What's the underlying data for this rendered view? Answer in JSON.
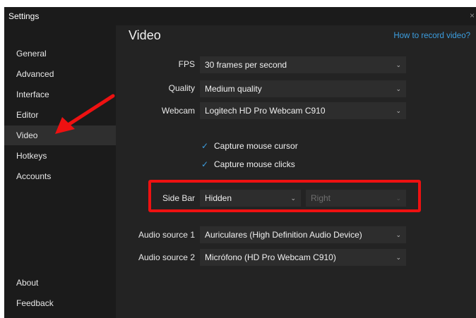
{
  "window": {
    "title": "Settings",
    "close_glyph": "×"
  },
  "sidebar": {
    "items": [
      {
        "label": "General"
      },
      {
        "label": "Advanced"
      },
      {
        "label": "Interface"
      },
      {
        "label": "Editor"
      },
      {
        "label": "Video"
      },
      {
        "label": "Hotkeys"
      },
      {
        "label": "Accounts"
      }
    ],
    "bottom_items": [
      {
        "label": "About"
      },
      {
        "label": "Feedback"
      }
    ],
    "active": "Video"
  },
  "main": {
    "title": "Video",
    "help_link": "How to record video?",
    "fps": {
      "label": "FPS",
      "value": "30 frames per second"
    },
    "quality": {
      "label": "Quality",
      "value": "Medium quality"
    },
    "webcam": {
      "label": "Webcam",
      "value": "Logitech HD Pro Webcam C910"
    },
    "capture_cursor": {
      "label": "Capture mouse cursor",
      "checked": true
    },
    "capture_clicks": {
      "label": "Capture mouse clicks",
      "checked": true
    },
    "side_bar": {
      "label": "Side Bar",
      "value": "Hidden",
      "position": "Right"
    },
    "audio1": {
      "label": "Audio source 1",
      "value": "Auriculares (High Definition Audio Device)"
    },
    "audio2": {
      "label": "Audio source 2",
      "value": "Micrófono (HD Pro Webcam C910)"
    }
  },
  "icons": {
    "chevron": "chevron-down-icon",
    "check": "checkmark-icon",
    "close": "close-icon"
  },
  "colors": {
    "accent": "#3c9ee0",
    "highlight_red": "#ee1111",
    "window_bg": "#1b1b1b",
    "content_bg": "#232323"
  }
}
